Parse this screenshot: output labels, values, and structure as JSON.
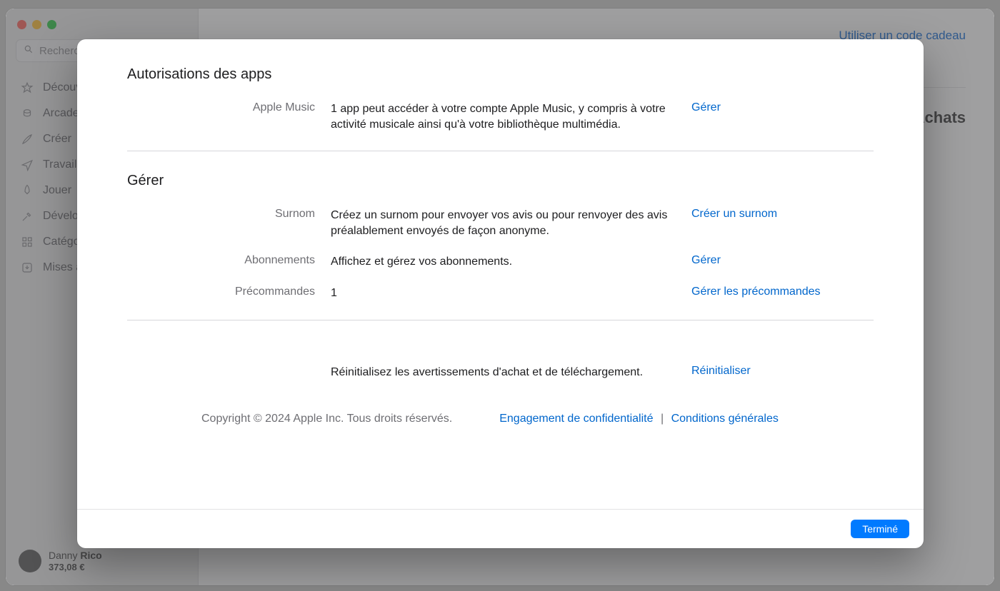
{
  "sidebar": {
    "search_placeholder": "Rechercher",
    "items": [
      {
        "label": "Découvrir"
      },
      {
        "label": "Arcade"
      },
      {
        "label": "Créer"
      },
      {
        "label": "Travailler"
      },
      {
        "label": "Jouer"
      },
      {
        "label": "Développer"
      },
      {
        "label": "Catégories"
      },
      {
        "label": "Mises à jour"
      }
    ],
    "user": {
      "first": "Danny",
      "last": "Rico",
      "balance": "373,08 €"
    }
  },
  "main": {
    "top_link": "Utiliser un code cadeau",
    "tab": "Achats"
  },
  "modal": {
    "sections": {
      "auth": {
        "title": "Autorisations des apps",
        "row_label": "Apple Music",
        "row_desc": "1 app peut accéder à votre compte Apple Music, y compris à votre activité musicale ainsi qu'à votre bibliothèque multimédia.",
        "row_action": "Gérer"
      },
      "manage": {
        "title": "Gérer",
        "nickname": {
          "label": "Surnom",
          "desc": "Créez un surnom pour envoyer vos avis ou pour renvoyer des avis préalablement envoyés de façon anonyme.",
          "action": "Créer un surnom"
        },
        "subs": {
          "label": "Abonnements",
          "desc": "Affichez et gérez vos abonnements.",
          "action": "Gérer"
        },
        "preorders": {
          "label": "Précommandes",
          "desc": "1",
          "action": "Gérer les précommandes"
        },
        "reset": {
          "desc": "Réinitialisez les avertissements d'achat et de téléchargement.",
          "action": "Réinitialiser"
        }
      }
    },
    "footer": {
      "copyright": "Copyright © 2024 Apple Inc. Tous droits réservés.",
      "privacy": "Engagement de confidentialité",
      "terms": "Conditions générales"
    },
    "done": "Terminé"
  }
}
